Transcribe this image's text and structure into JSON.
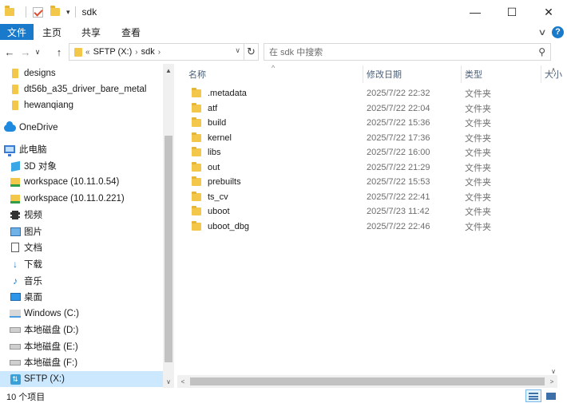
{
  "window": {
    "title": "sdk",
    "minimize_glyph": "—",
    "maximize_glyph": "☐",
    "close_glyph": "✕",
    "quick_access_dropdown": "▾"
  },
  "ribbon": {
    "tabs": [
      {
        "label": "文件"
      },
      {
        "label": "主页"
      },
      {
        "label": "共享"
      },
      {
        "label": "查看"
      }
    ],
    "help_glyph": "?",
    "collapse_glyph": "∨",
    "file_tab_color": "#1979ca"
  },
  "nav_buttons": {
    "back_glyph": "←",
    "forward_glyph": "→",
    "recent_glyph": "∨",
    "up_glyph": "↑"
  },
  "address": {
    "overflow": "«",
    "crumbs": [
      "SFTP (X:)",
      "sdk"
    ],
    "separator": "›",
    "dropdown_glyph": "∨",
    "refresh_glyph": "↻"
  },
  "search": {
    "placeholder": "在 sdk 中搜索",
    "icon_glyph": "⚲"
  },
  "sidebar": {
    "items": [
      {
        "label": "designs",
        "icon": "pinned-folder-icon"
      },
      {
        "label": "dt56b_a35_driver_bare_metal",
        "icon": "pinned-folder-icon"
      },
      {
        "label": "hewanqiang",
        "icon": "pinned-folder-icon"
      },
      {
        "label": "OneDrive",
        "icon": "onedrive-icon"
      },
      {
        "label": "此电脑",
        "icon": "this-pc-icon"
      },
      {
        "label": "3D 对象",
        "icon": "3d-objects-icon"
      },
      {
        "label": "workspace (10.11.0.54)",
        "icon": "network-drive-icon"
      },
      {
        "label": "workspace (10.11.0.221)",
        "icon": "network-drive-icon"
      },
      {
        "label": "视频",
        "icon": "videos-icon"
      },
      {
        "label": "图片",
        "icon": "pictures-icon"
      },
      {
        "label": "文档",
        "icon": "documents-icon"
      },
      {
        "label": "下载",
        "icon": "downloads-icon"
      },
      {
        "label": "音乐",
        "icon": "music-icon"
      },
      {
        "label": "桌面",
        "icon": "desktop-icon"
      },
      {
        "label": "Windows (C:)",
        "icon": "windows-drive-icon"
      },
      {
        "label": "本地磁盘 (D:)",
        "icon": "local-disk-icon"
      },
      {
        "label": "本地磁盘 (E:)",
        "icon": "local-disk-icon"
      },
      {
        "label": "本地磁盘 (F:)",
        "icon": "local-disk-icon"
      },
      {
        "label": "SFTP (X:)",
        "icon": "sftp-drive-icon",
        "selected": true
      }
    ],
    "selected_color": "#cce8ff"
  },
  "file_list": {
    "columns": {
      "name": "名称",
      "date": "修改日期",
      "type": "类型",
      "size": "大小"
    },
    "sort_glyph": "^",
    "rows": [
      {
        "name": ".metadata",
        "date": "2025/7/22 22:32",
        "type": "文件夹"
      },
      {
        "name": "atf",
        "date": "2025/7/22 22:04",
        "type": "文件夹"
      },
      {
        "name": "build",
        "date": "2025/7/22 15:36",
        "type": "文件夹"
      },
      {
        "name": "kernel",
        "date": "2025/7/22 17:36",
        "type": "文件夹"
      },
      {
        "name": "libs",
        "date": "2025/7/22 16:00",
        "type": "文件夹"
      },
      {
        "name": "out",
        "date": "2025/7/22 21:29",
        "type": "文件夹"
      },
      {
        "name": "prebuilts",
        "date": "2025/7/22 15:53",
        "type": "文件夹"
      },
      {
        "name": "ts_cv",
        "date": "2025/7/22 22:41",
        "type": "文件夹"
      },
      {
        "name": "uboot",
        "date": "2025/7/23 11:42",
        "type": "文件夹"
      },
      {
        "name": "uboot_dbg",
        "date": "2025/7/22 22:46",
        "type": "文件夹"
      }
    ],
    "folder_color": "#f3c74a"
  },
  "scroll": {
    "up_glyph": "▲",
    "down_glyph": "▼",
    "left_glyph": "◀",
    "right_glyph": "▶",
    "small_up_glyph": "∧",
    "small_down_glyph": "∨",
    "small_left_glyph": "<",
    "small_right_glyph": ">"
  },
  "status": {
    "item_count": "10 个项目"
  }
}
